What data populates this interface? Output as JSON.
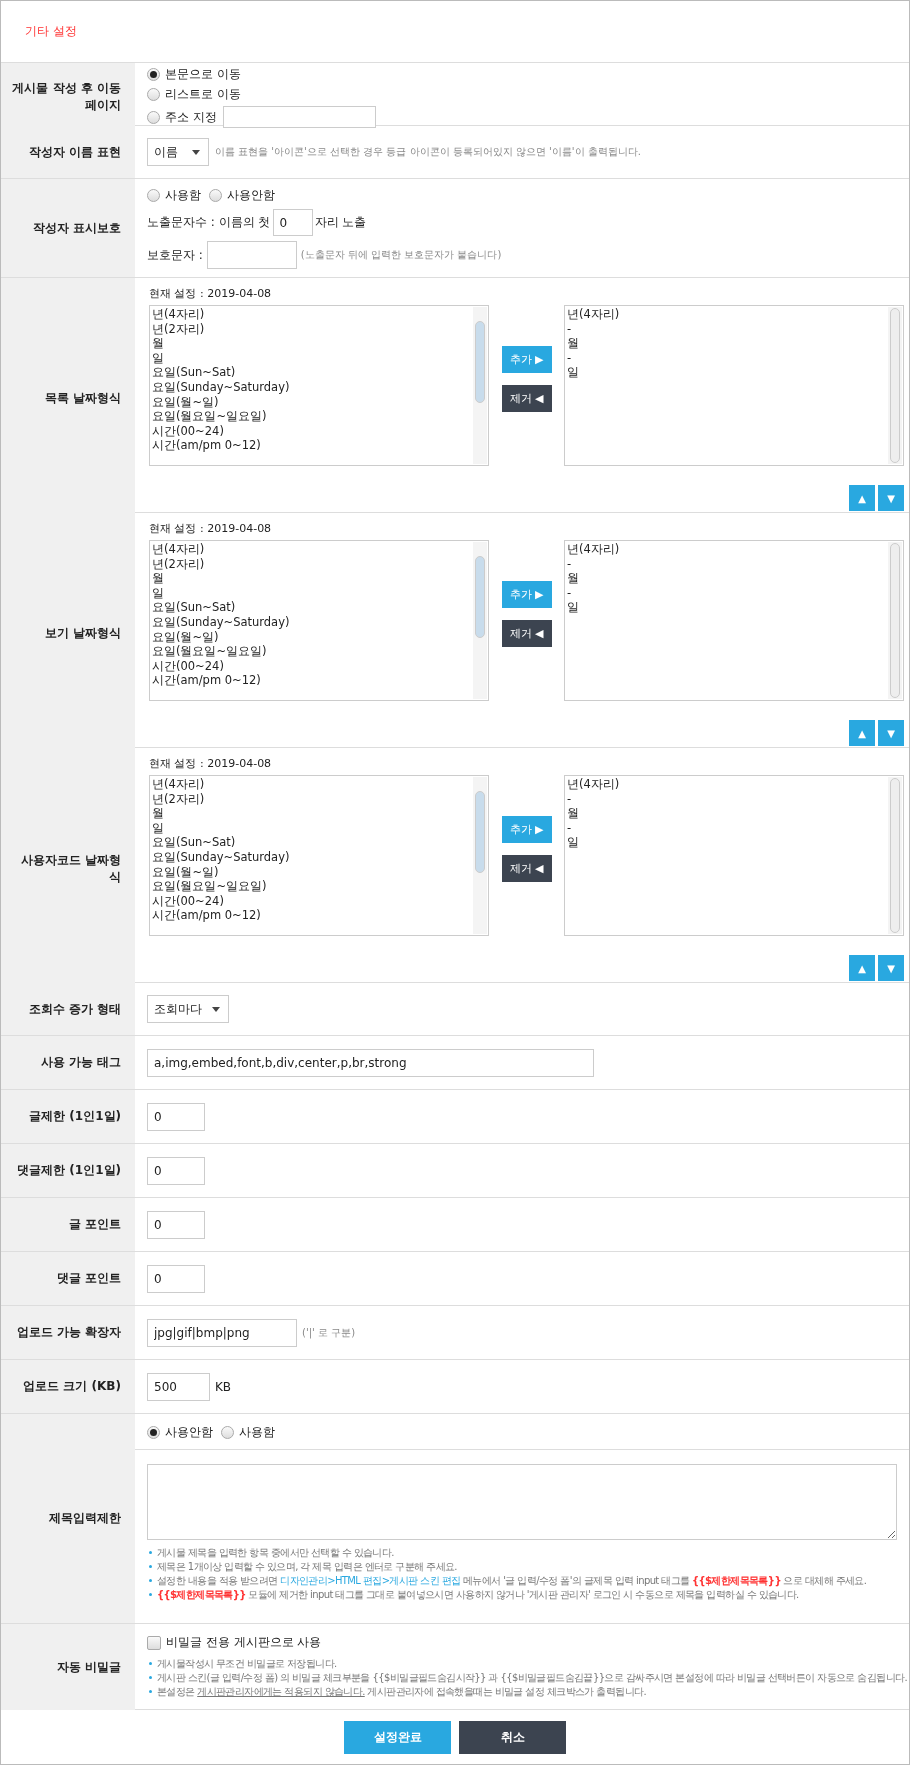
{
  "header": {
    "title": "기타 설정"
  },
  "rows": [
    {
      "kind": "redirect",
      "label": "게시물 작성 후 이동페이지",
      "options": [
        {
          "label": "본문으로 이동",
          "selected": true
        },
        {
          "label": "리스트로 이동",
          "selected": false
        },
        {
          "label": "주소 지정",
          "selected": false
        }
      ]
    },
    {
      "kind": "select",
      "label": "작성자 이름 표현",
      "value": "이름",
      "note": "이름 표현을 '아이콘'으로 선택한 경우 등급 아이콘이 등록되어있지 않으면 '이름'이 출력됩니다."
    },
    {
      "kind": "protect",
      "label": "작성자 표시보호",
      "options": [
        {
          "label": "사용함",
          "selected": false
        },
        {
          "label": "사용안함",
          "selected": false
        }
      ],
      "count_label": "노출문자수 : 이름의 첫",
      "count_value": "0",
      "count_suffix": "자리 노출",
      "char_label": "보호문자 :",
      "char_note": "(노출문자 뒤에 입력한 보호문자가 붙습니다)"
    },
    {
      "kind": "date",
      "label": "목록 날짜형식",
      "current": "현재 설정 : 2019-04-08",
      "available": [
        "년(4자리)",
        "년(2자리)",
        "월",
        "일",
        "요일(Sun~Sat)",
        "요일(Sunday~Saturday)",
        "요일(월~일)",
        "요일(월요일~일요일)",
        "시간(00~24)",
        "시간(am/pm 0~12)"
      ],
      "chosen": [
        "년(4자리)",
        "-",
        "월",
        "-",
        "일"
      ],
      "add": "추가 ▶",
      "remove": "제거 ◀",
      "up": "▲",
      "down": "▼"
    },
    {
      "kind": "date",
      "label": "보기 날짜형식",
      "current": "현재 설정 : 2019-04-08",
      "available": [
        "년(4자리)",
        "년(2자리)",
        "월",
        "일",
        "요일(Sun~Sat)",
        "요일(Sunday~Saturday)",
        "요일(월~일)",
        "요일(월요일~일요일)",
        "시간(00~24)",
        "시간(am/pm 0~12)"
      ],
      "chosen": [
        "년(4자리)",
        "-",
        "월",
        "-",
        "일"
      ],
      "add": "추가 ▶",
      "remove": "제거 ◀",
      "up": "▲",
      "down": "▼"
    },
    {
      "kind": "date",
      "label": "사용자코드 날짜형식",
      "current": "현재 설정 : 2019-04-08",
      "available": [
        "년(4자리)",
        "년(2자리)",
        "월",
        "일",
        "요일(Sun~Sat)",
        "요일(Sunday~Saturday)",
        "요일(월~일)",
        "요일(월요일~일요일)",
        "시간(00~24)",
        "시간(am/pm 0~12)"
      ],
      "chosen": [
        "년(4자리)",
        "-",
        "월",
        "-",
        "일"
      ],
      "add": "추가 ▶",
      "remove": "제거 ◀",
      "up": "▲",
      "down": "▼"
    },
    {
      "kind": "select",
      "label": "조회수 증가 형태",
      "value": "조회마다"
    },
    {
      "kind": "wide_text",
      "label": "사용 가능 태그",
      "value": "a,img,embed,font,b,div,center,p,br,strong"
    },
    {
      "kind": "text",
      "label": "글제한 (1인1일)",
      "value": "0"
    },
    {
      "kind": "text",
      "label": "댓글제한 (1인1일)",
      "value": "0"
    },
    {
      "kind": "text",
      "label": "글 포인트",
      "value": "0"
    },
    {
      "kind": "text",
      "label": "댓글 포인트",
      "value": "0"
    },
    {
      "kind": "text",
      "label": "업로드 가능 확장자",
      "value": "jpg|gif|bmp|png",
      "note": "('|' 로 구분)"
    },
    {
      "kind": "text",
      "label": "업로드 크기 (KB)",
      "value": "500",
      "unit": "KB"
    },
    {
      "kind": "title_limit",
      "label": "제목입력제한",
      "options": [
        {
          "label": "사용안함",
          "selected": true
        },
        {
          "label": "사용함",
          "selected": false
        }
      ],
      "notes": [
        [
          {
            "kind": "plain",
            "text": "게시물 제목을 입력한 항목 중에서만 선택할 수 있습니다."
          }
        ],
        [
          {
            "kind": "plain",
            "text": "제목은 1개이상 입력할 수 있으며, 각 제목 입력은 엔터로 구분해 주세요."
          }
        ],
        [
          {
            "kind": "plain",
            "text": "설정한 내용을 적용 받으려면 "
          },
          {
            "kind": "link",
            "text": "디자인관리>HTML 편집>게시판 스킨 편집"
          },
          {
            "kind": "plain",
            "text": " 메뉴에서 '글 입력/수정 폼'의 글제목 입력 input 태그를 "
          },
          {
            "kind": "code",
            "text": "{{$제한제목목록}}"
          },
          {
            "kind": "plain",
            "text": " 으로 대체해 주세요."
          }
        ],
        [
          {
            "kind": "code",
            "text": "{{$제한제목목록}}"
          },
          {
            "kind": "plain",
            "text": " 모듈에 제거한 input 태그를 그대로 붙여넣으시면 사용하지 않거나 '게시판 관리자' 로그인 시 수동으로 제목을 입력하실 수 있습니다."
          }
        ]
      ]
    },
    {
      "kind": "secret",
      "label": "자동 비밀글",
      "checkbox": {
        "label": "비밀글 전용 게시판으로 사용",
        "checked": false
      },
      "notes": [
        [
          {
            "kind": "plain",
            "text": "게시물작성시 무조건 비밀글로 저장됩니다."
          }
        ],
        [
          {
            "kind": "plain",
            "text": "게시판 스킨(글 입력/수정 폼) 의 비밀글 체크부분을 {{$비밀글필드숨김시작}} 과 {{$비밀글필드숨김끝}}으로 감싸주시면 본설정에 따라 비밀글 선택버튼이 자동으로 숨김됩니다."
          }
        ],
        [
          {
            "kind": "plain",
            "text": "본설정은 "
          },
          {
            "kind": "underline",
            "text": "게시판관리자에게는 적용되지 않습니다."
          },
          {
            "kind": "plain",
            "text": " 게시판관리자에 접속했을때는 비밀글 설정 체크박스가 출력됩니다."
          }
        ]
      ]
    }
  ],
  "buttons": [
    {
      "label": "설정완료",
      "kind": "primary"
    },
    {
      "label": "취소",
      "kind": "secondary"
    }
  ]
}
